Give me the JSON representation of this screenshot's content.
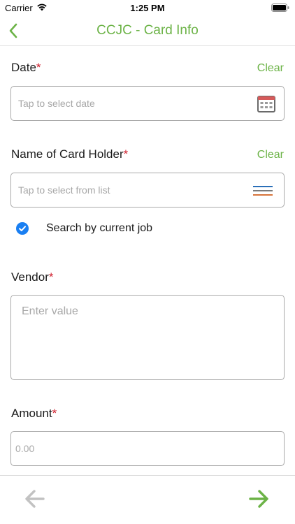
{
  "status_bar": {
    "carrier": "Carrier",
    "time": "1:25 PM"
  },
  "nav": {
    "title": "CCJC - Card Info",
    "accent_color": "#6cb347"
  },
  "form": {
    "date": {
      "label": "Date",
      "required_mark": "*",
      "clear_label": "Clear",
      "placeholder": "Tap to select date",
      "icon": "calendar-icon"
    },
    "card_holder": {
      "label": "Name of Card Holder",
      "required_mark": "*",
      "clear_label": "Clear",
      "placeholder": "Tap to select from list",
      "icon": "list-icon"
    },
    "search_by_job": {
      "label": "Search by current job",
      "checked": true,
      "color": "#1a7ff2"
    },
    "vendor": {
      "label": "Vendor",
      "required_mark": "*",
      "placeholder": "Enter value"
    },
    "amount": {
      "label": "Amount",
      "required_mark": "*",
      "placeholder": "0.00"
    }
  },
  "footer": {
    "prev_icon": "arrow-left-icon",
    "next_icon": "arrow-right-icon",
    "prev_enabled": false,
    "next_enabled": true
  }
}
